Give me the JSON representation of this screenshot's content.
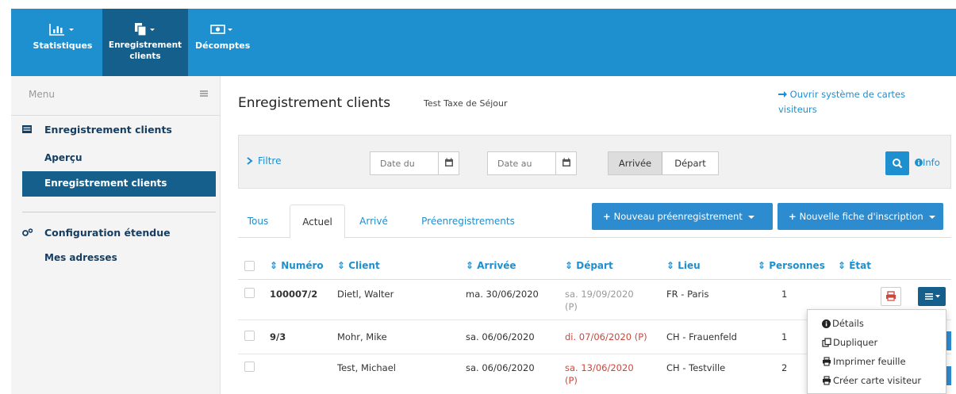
{
  "topnav": {
    "items": [
      {
        "label": "Statistiques",
        "icon": "bar-chart-icon"
      },
      {
        "label_line1": "Enregistrement",
        "label_line2": "clients",
        "icon": "documents-icon",
        "active": true
      },
      {
        "label": "Décomptes",
        "icon": "banknote-icon"
      }
    ],
    "colors": {
      "bar": "#1e8fcf",
      "active": "#155f8d"
    }
  },
  "sidebar": {
    "menu_label": "Menu",
    "sections": [
      {
        "title": "Enregistrement clients",
        "icon": "list-icon",
        "items": [
          {
            "label": "Aperçu"
          },
          {
            "label": "Enregistrement clients",
            "active": true
          }
        ]
      },
      {
        "title": "Configuration étendue",
        "icon": "gears-icon",
        "items": [
          {
            "label": "Mes adresses"
          }
        ]
      }
    ]
  },
  "page": {
    "title": "Enregistrement clients",
    "subtitle": "Test Taxe de Séjour",
    "ext_link": "Ouvrir système de cartes visiteurs"
  },
  "filter": {
    "label": "Filtre",
    "date_from_placeholder": "Date du",
    "date_to_placeholder": "Date au",
    "toggle": [
      "Arrivée",
      "Départ"
    ],
    "toggle_selected": "Arrivée",
    "info_label": "Info"
  },
  "tabs": [
    {
      "label": "Tous"
    },
    {
      "label": "Actuel",
      "active": true
    },
    {
      "label": "Arrivé"
    },
    {
      "label": "Préenregistrements"
    }
  ],
  "actions": {
    "new_prereg": "Nouveau préenregistrement",
    "new_form": "Nouvelle fiche d'inscription"
  },
  "table": {
    "columns": [
      "Numéro",
      "Client",
      "Arrivée",
      "Départ",
      "Lieu",
      "Personnes",
      "État"
    ],
    "rows": [
      {
        "numero": "100007/2",
        "client": "Dietl, Walter",
        "arrivee": "ma. 30/06/2020",
        "depart": "sa. 19/09/2020",
        "depart_suffix": "(P)",
        "lieu": "FR - Paris",
        "personnes": "1"
      },
      {
        "numero": "9/3",
        "client": "Mohr, Mike",
        "arrivee": "sa. 06/06/2020",
        "depart": "di. 07/06/2020 (P)",
        "lieu": "CH - Frauenfeld",
        "personnes": "1"
      },
      {
        "numero": "",
        "client": "Test, Michael",
        "arrivee": "sa. 06/06/2020",
        "depart": "sa. 13/06/2020",
        "depart_suffix": "(P)",
        "lieu": "CH - Testville",
        "personnes": "2"
      }
    ]
  },
  "dropdown": {
    "items": [
      {
        "label": "Détails",
        "icon": "info-icon"
      },
      {
        "label": "Dupliquer",
        "icon": "copy-icon"
      },
      {
        "label": "Imprimer feuille",
        "icon": "printer-icon"
      },
      {
        "label": "Créer carte visiteur",
        "icon": "printer-icon"
      }
    ]
  }
}
